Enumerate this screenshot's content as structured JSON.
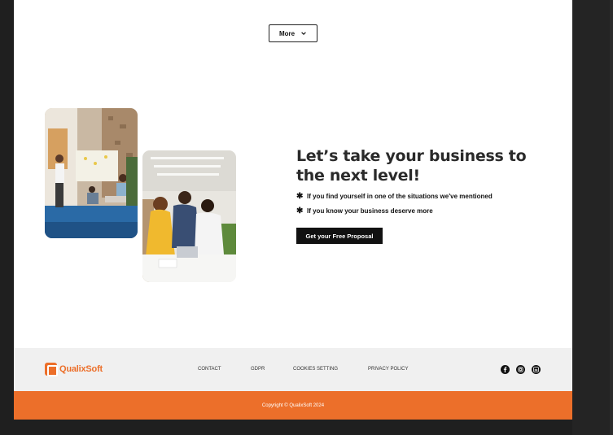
{
  "more_button": {
    "label": "More",
    "icon": "chevron-down-icon"
  },
  "hero": {
    "headline": "Let’s take your business to the next level!",
    "bullets": [
      {
        "icon": "asterisk-icon",
        "text": "If you find yourself in one of the situations we've mentioned"
      },
      {
        "icon": "asterisk-icon",
        "text": "If you know your business deserve more"
      }
    ],
    "cta_label": "Get your Free Proposal"
  },
  "images": [
    {
      "name": "office-presentation-photo"
    },
    {
      "name": "team-at-laptop-photo"
    }
  ],
  "footer": {
    "brand": "QualixSoft",
    "links": [
      "CONTACT",
      "GDPR",
      "COOKIES SETTING",
      "PRIVACY POLICY"
    ],
    "social": [
      "facebook-icon",
      "instagram-icon",
      "linkedin-icon"
    ],
    "copyright": "Copyright © QualixSoft 2024"
  },
  "colors": {
    "brand_orange": "#ec6f2a",
    "text_dark": "#2a2a2a",
    "footer_bg": "#f0f0f0"
  }
}
